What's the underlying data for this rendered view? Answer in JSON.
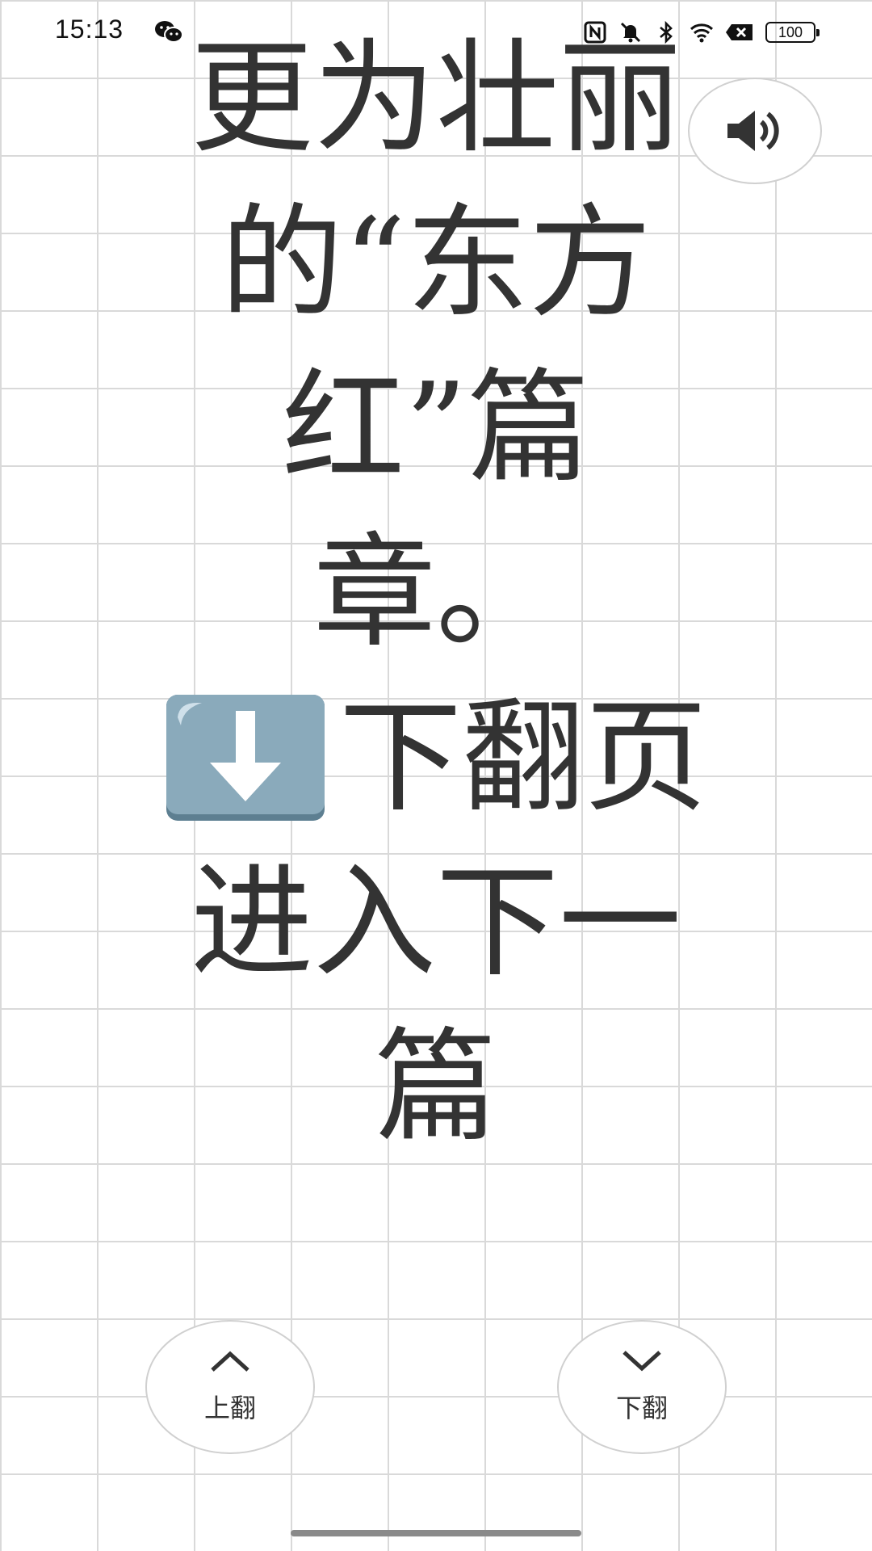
{
  "status_bar": {
    "time": "15:13",
    "battery": "100",
    "icons": [
      "wechat-icon",
      "nfc-icon",
      "mute-bell-icon",
      "bluetooth-icon",
      "wifi-icon",
      "close-icon",
      "battery-icon"
    ]
  },
  "content": {
    "lines": [
      "更为壮丽",
      "的“东方",
      "红”篇",
      "章。"
    ],
    "next_line": "下翻页",
    "tail_lines": [
      "进入下一",
      "篇"
    ],
    "emoji": "down-arrow-emoji"
  },
  "speaker": {
    "icon": "speaker-icon"
  },
  "controls": {
    "up_label": "上翻",
    "down_label": "下翻"
  },
  "colors": {
    "text": "#333333",
    "grid": "#d9d9d9",
    "button_border": "#d0d0d0",
    "emoji_blue": "#8aaabb"
  }
}
